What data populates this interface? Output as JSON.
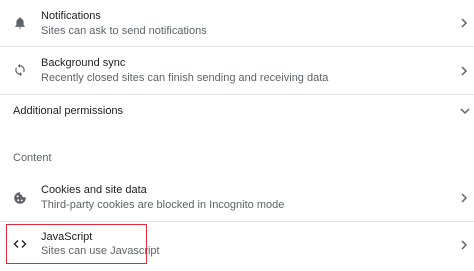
{
  "settings": {
    "notifications": {
      "title": "Notifications",
      "subtitle": "Sites can ask to send notifications",
      "icon": "bell-icon"
    },
    "background_sync": {
      "title": "Background sync",
      "subtitle": "Recently closed sites can finish sending and receiving data",
      "icon": "sync-icon"
    },
    "additional_permissions": {
      "label": "Additional permissions",
      "icon": "chevron-down-icon"
    },
    "content_section": {
      "heading": "Content"
    },
    "cookies": {
      "title": "Cookies and site data",
      "subtitle": "Third-party cookies are blocked in Incognito mode",
      "icon": "cookie-icon"
    },
    "javascript": {
      "title": "JavaScript",
      "subtitle": "Sites can use Javascript",
      "icon": "code-icon",
      "highlighted": true
    }
  },
  "colors": {
    "highlight": "#e2293a",
    "icon": "#5f6368",
    "divider": "#e3e3e3"
  }
}
